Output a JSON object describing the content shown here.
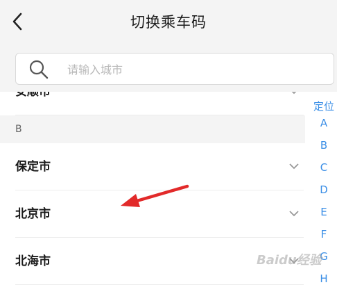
{
  "header": {
    "title": "切换乘车码",
    "search_placeholder": "请输入城市"
  },
  "list": {
    "partial_row": "安顺市",
    "section_label": "B",
    "rows": [
      {
        "name": "保定市"
      },
      {
        "name": "北京市"
      },
      {
        "name": "北海市"
      }
    ]
  },
  "index_bar": {
    "items": [
      "定位",
      "A",
      "B",
      "C",
      "D",
      "E",
      "F",
      "G",
      "H"
    ]
  },
  "watermark": "Baidu经验",
  "colors": {
    "accent": "#3a8ee6",
    "annotation_arrow": "#e22a2a",
    "header_bg": "#f4f4f4"
  }
}
